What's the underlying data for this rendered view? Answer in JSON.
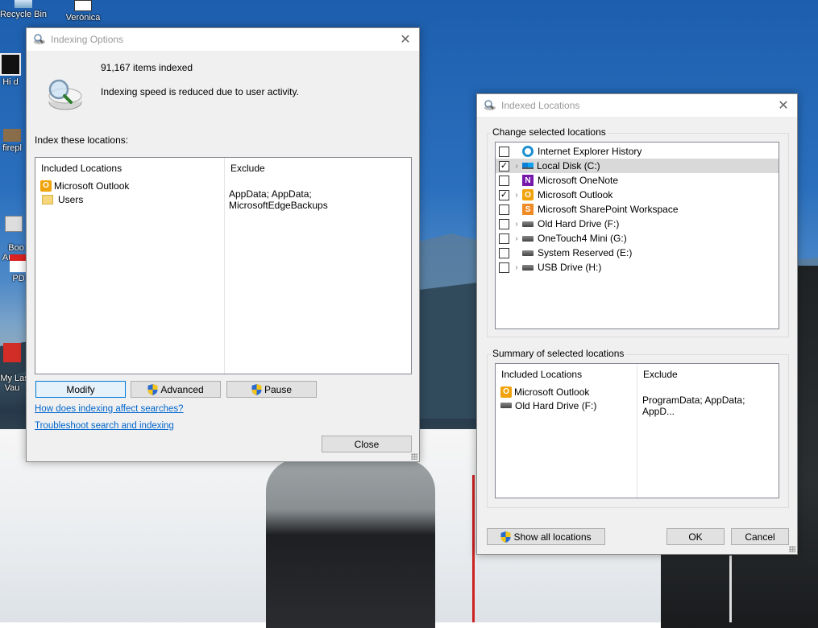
{
  "desktop": {
    "icons": [
      {
        "label": "Recycle Bin"
      },
      {
        "label": "Verónica"
      },
      {
        "label": "Hi d"
      },
      {
        "label": "firepl"
      },
      {
        "label": "Boo\nAutos"
      },
      {
        "label": "PD"
      },
      {
        "label": "My Las\nVau"
      }
    ]
  },
  "indexing_options": {
    "title": "Indexing Options",
    "items_indexed": "91,167 items indexed",
    "status": "Indexing speed is reduced due to user activity.",
    "index_label": "Index these locations:",
    "columns": {
      "included": "Included Locations",
      "exclude": "Exclude"
    },
    "rows": [
      {
        "location": "Microsoft Outlook",
        "icon": "outlook-icon",
        "exclude": ""
      },
      {
        "location": "Users",
        "icon": "folder-icon",
        "exclude": "AppData; AppData; MicrosoftEdgeBackups"
      }
    ],
    "buttons": {
      "modify": "Modify",
      "advanced": "Advanced",
      "pause": "Pause",
      "close": "Close"
    },
    "links": {
      "how": "How does indexing affect searches?",
      "troubleshoot": "Troubleshoot search and indexing"
    }
  },
  "indexed_locations": {
    "title": "Indexed Locations",
    "change_label": "Change selected locations",
    "tree": [
      {
        "label": "Internet Explorer History",
        "checked": false,
        "expandable": false,
        "icon": "ie-icon"
      },
      {
        "label": "Local Disk (C:)",
        "checked": true,
        "expandable": true,
        "icon": "windows-drive-icon",
        "selected": true
      },
      {
        "label": "Microsoft OneNote",
        "checked": false,
        "expandable": false,
        "icon": "onenote-icon"
      },
      {
        "label": "Microsoft Outlook",
        "checked": true,
        "expandable": true,
        "icon": "outlook-icon"
      },
      {
        "label": "Microsoft SharePoint Workspace",
        "checked": false,
        "expandable": false,
        "icon": "sharepoint-icon"
      },
      {
        "label": "Old Hard Drive (F:)",
        "checked": false,
        "expandable": true,
        "icon": "drive-icon"
      },
      {
        "label": "OneTouch4 Mini (G:)",
        "checked": false,
        "expandable": true,
        "icon": "drive-icon"
      },
      {
        "label": "System Reserved (E:)",
        "checked": false,
        "expandable": false,
        "icon": "drive-icon"
      },
      {
        "label": "USB Drive (H:)",
        "checked": false,
        "expandable": true,
        "icon": "drive-icon"
      }
    ],
    "summary_label": "Summary of selected locations",
    "columns": {
      "included": "Included Locations",
      "exclude": "Exclude"
    },
    "summary": [
      {
        "location": "Microsoft Outlook",
        "icon": "outlook-icon",
        "exclude": ""
      },
      {
        "location": "Old Hard Drive (F:)",
        "icon": "drive-icon",
        "exclude": "ProgramData; AppData; AppD..."
      }
    ],
    "buttons": {
      "show_all": "Show all locations",
      "ok": "OK",
      "cancel": "Cancel"
    }
  }
}
